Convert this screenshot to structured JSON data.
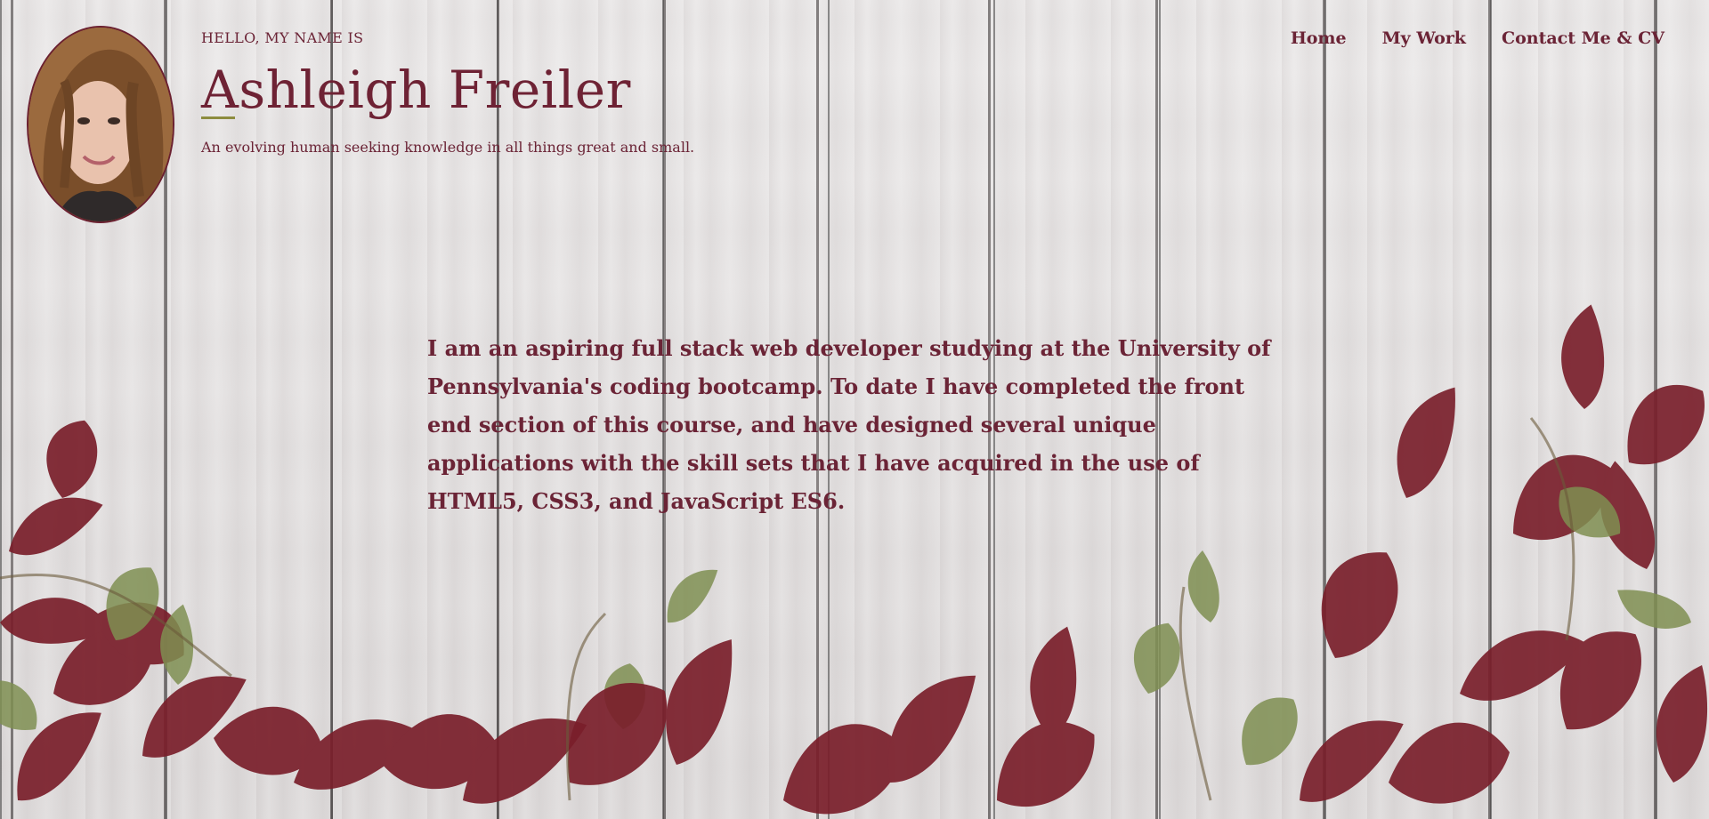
{
  "header": {
    "greeting": "HELLO, MY NAME IS",
    "name": "Ashleigh Freiler",
    "tagline": "An evolving human seeking knowledge in all things great and small.",
    "avatar_alt": "Portrait of Ashleigh Freiler"
  },
  "nav": {
    "items": [
      {
        "label": "Home"
      },
      {
        "label": "My Work"
      },
      {
        "label": "Contact Me & CV"
      }
    ]
  },
  "main": {
    "bio": "I am an aspiring full stack web developer studying at the University of Pennsylvania's coding bootcamp. To date I have completed the front end section of this course, and have designed several unique applications with the skill sets that I have acquired in the use of HTML5, CSS3, and JavaScript ES6."
  },
  "colors": {
    "text_accent": "#6b2436",
    "leaf_red": "#7a1f2b",
    "leaf_green": "#7f8f52",
    "underline_olive": "#8d8c3e",
    "wood_background": "#e7e5e4"
  }
}
